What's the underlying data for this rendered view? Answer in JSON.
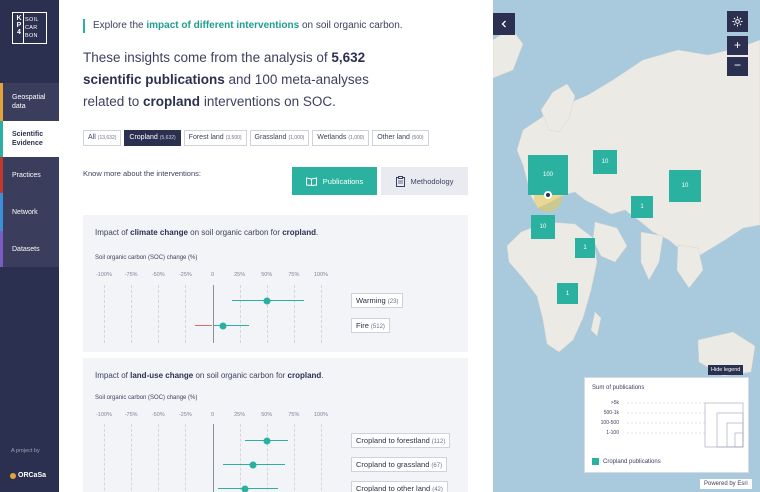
{
  "sidebar": {
    "logo": {
      "kp": "KP4",
      "words": [
        "SOIL",
        "CAR",
        "BON"
      ]
    },
    "items": [
      {
        "label": "Geospatial data",
        "accent": "#e3a437"
      },
      {
        "label": "Scientific Evidence",
        "accent": "#29b0a0"
      },
      {
        "label": "Practices",
        "accent": "#c0392b"
      },
      {
        "label": "Network",
        "accent": "#3b8fd8"
      },
      {
        "label": "Datasets",
        "accent": "#7b5cc4"
      }
    ],
    "project_label": "A project by",
    "project_name": "ORCaSa"
  },
  "intro": {
    "pre": "Explore the ",
    "highlight": "impact of different interventions",
    "post": " on soil organic carbon."
  },
  "headline": {
    "p1": "These insights come from the analysis of ",
    "b1": "5,632 scientific publications",
    "p2": " and 100 meta-analyses related to ",
    "b2": "cropland",
    "p3": " interventions on SOC."
  },
  "tabs": [
    {
      "label": "All",
      "count": "(13,632)",
      "active": false
    },
    {
      "label": "Cropland",
      "count": "(5,632)",
      "active": true
    },
    {
      "label": "Forest land",
      "count": "(3,500)",
      "active": false
    },
    {
      "label": "Grassland",
      "count": "(1,000)",
      "active": false
    },
    {
      "label": "Wetlands",
      "count": "(1,000)",
      "active": false
    },
    {
      "label": "Other land",
      "count": "(500)",
      "active": false
    }
  ],
  "interventions": {
    "prompt": "Know more about the interventions:",
    "publications_label": "Publications",
    "methodology_label": "Methodology"
  },
  "colors": {
    "accent": "#2bb1a0",
    "navy": "#2c3050",
    "negative": "#e06a6a"
  },
  "panels": [
    {
      "title_pre": "Impact of ",
      "title_b1": "climate change",
      "title_mid": " on soil organic carbon for ",
      "title_b2": "cropland",
      "title_post": ".",
      "axis_label": "Soil organic carbon (SOC) change (%)",
      "ticks": [
        "-100%",
        "-75%",
        "-50%",
        "-25%",
        "0",
        "25%",
        "50%",
        "75%",
        "100%"
      ],
      "rows": [
        {
          "label": "Warming",
          "count": "(23)",
          "mean": 50,
          "low": 18,
          "high": 84
        },
        {
          "label": "Fire",
          "count": "(512)",
          "mean": 10,
          "low": -16,
          "high": 34
        }
      ]
    },
    {
      "title_pre": "Impact of ",
      "title_b1": "land-use change",
      "title_mid": " on soil organic carbon for ",
      "title_b2": "cropland",
      "title_post": ".",
      "axis_label": "Soil organic carbon (SOC) change (%)",
      "ticks": [
        "-100%",
        "-75%",
        "-50%",
        "-25%",
        "0",
        "25%",
        "50%",
        "75%",
        "100%"
      ],
      "rows": [
        {
          "label": "Cropland to forestland",
          "count": "(112)",
          "mean": 50,
          "low": 30,
          "high": 70
        },
        {
          "label": "Cropland to grassland",
          "count": "(67)",
          "mean": 37,
          "low": 10,
          "high": 67
        },
        {
          "label": "Cropland to other land",
          "count": "(42)",
          "mean": 30,
          "low": 5,
          "high": 60
        }
      ]
    }
  ],
  "map": {
    "clusters": [
      {
        "label": "100",
        "size": "large"
      },
      {
        "label": "10",
        "size": "small"
      },
      {
        "label": "10",
        "size": "medium"
      },
      {
        "label": "1",
        "size": "small"
      },
      {
        "label": "10",
        "size": "small"
      },
      {
        "label": "1",
        "size": "small"
      },
      {
        "label": "1",
        "size": "small"
      }
    ],
    "hide_legend_label": "Hide legend",
    "legend_title": "Sum of publications",
    "legend_sizes": [
      ">5k",
      "500-1k",
      "100-500",
      "1-100"
    ],
    "legend_item": "Cropland publications",
    "attribution": "Powered by Esri",
    "icons": [
      "chevron-left-icon",
      "gear-icon",
      "plus-icon",
      "minus-icon"
    ]
  }
}
